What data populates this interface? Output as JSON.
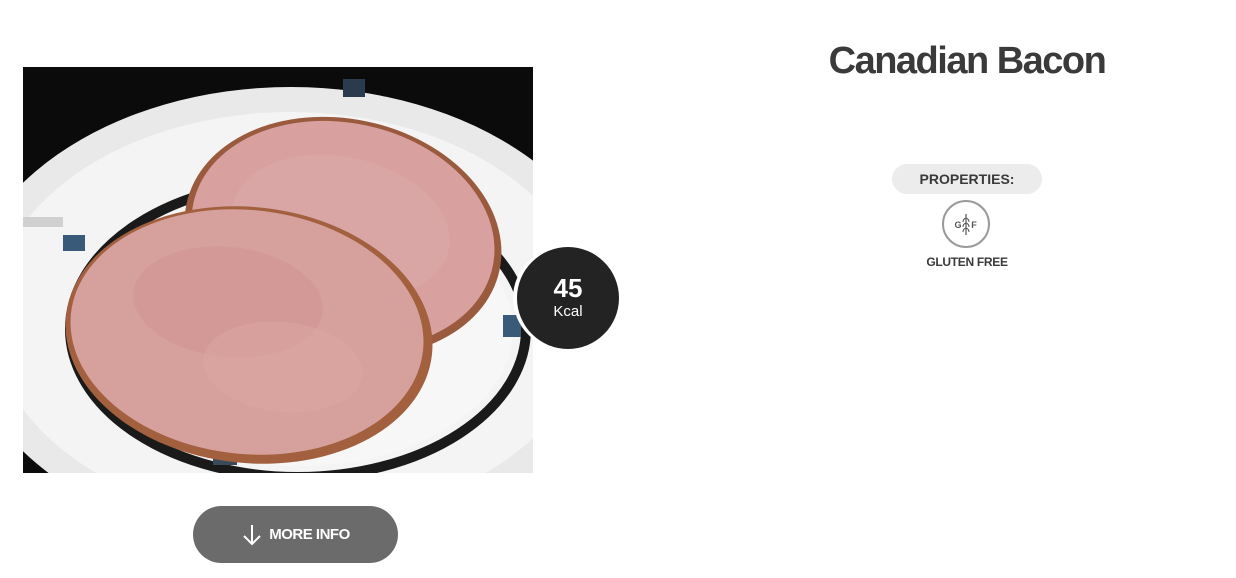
{
  "product": {
    "title": "Canadian Bacon",
    "image_alt": "Canadian Bacon",
    "calories": {
      "value": "45",
      "unit": "Kcal"
    },
    "more_info_label": "MORE INFO"
  },
  "properties": {
    "heading": "PROPERTIES:",
    "items": [
      {
        "icon": "gluten-free-icon",
        "icon_text_left": "G",
        "icon_text_right": "F",
        "label": "GLUTEN FREE"
      }
    ]
  },
  "colors": {
    "title_text": "#3a3a3a",
    "badge_bg": "#232323",
    "button_bg": "#6b6b6b",
    "pill_bg": "#ececec",
    "page_bg": "#ffffff"
  }
}
